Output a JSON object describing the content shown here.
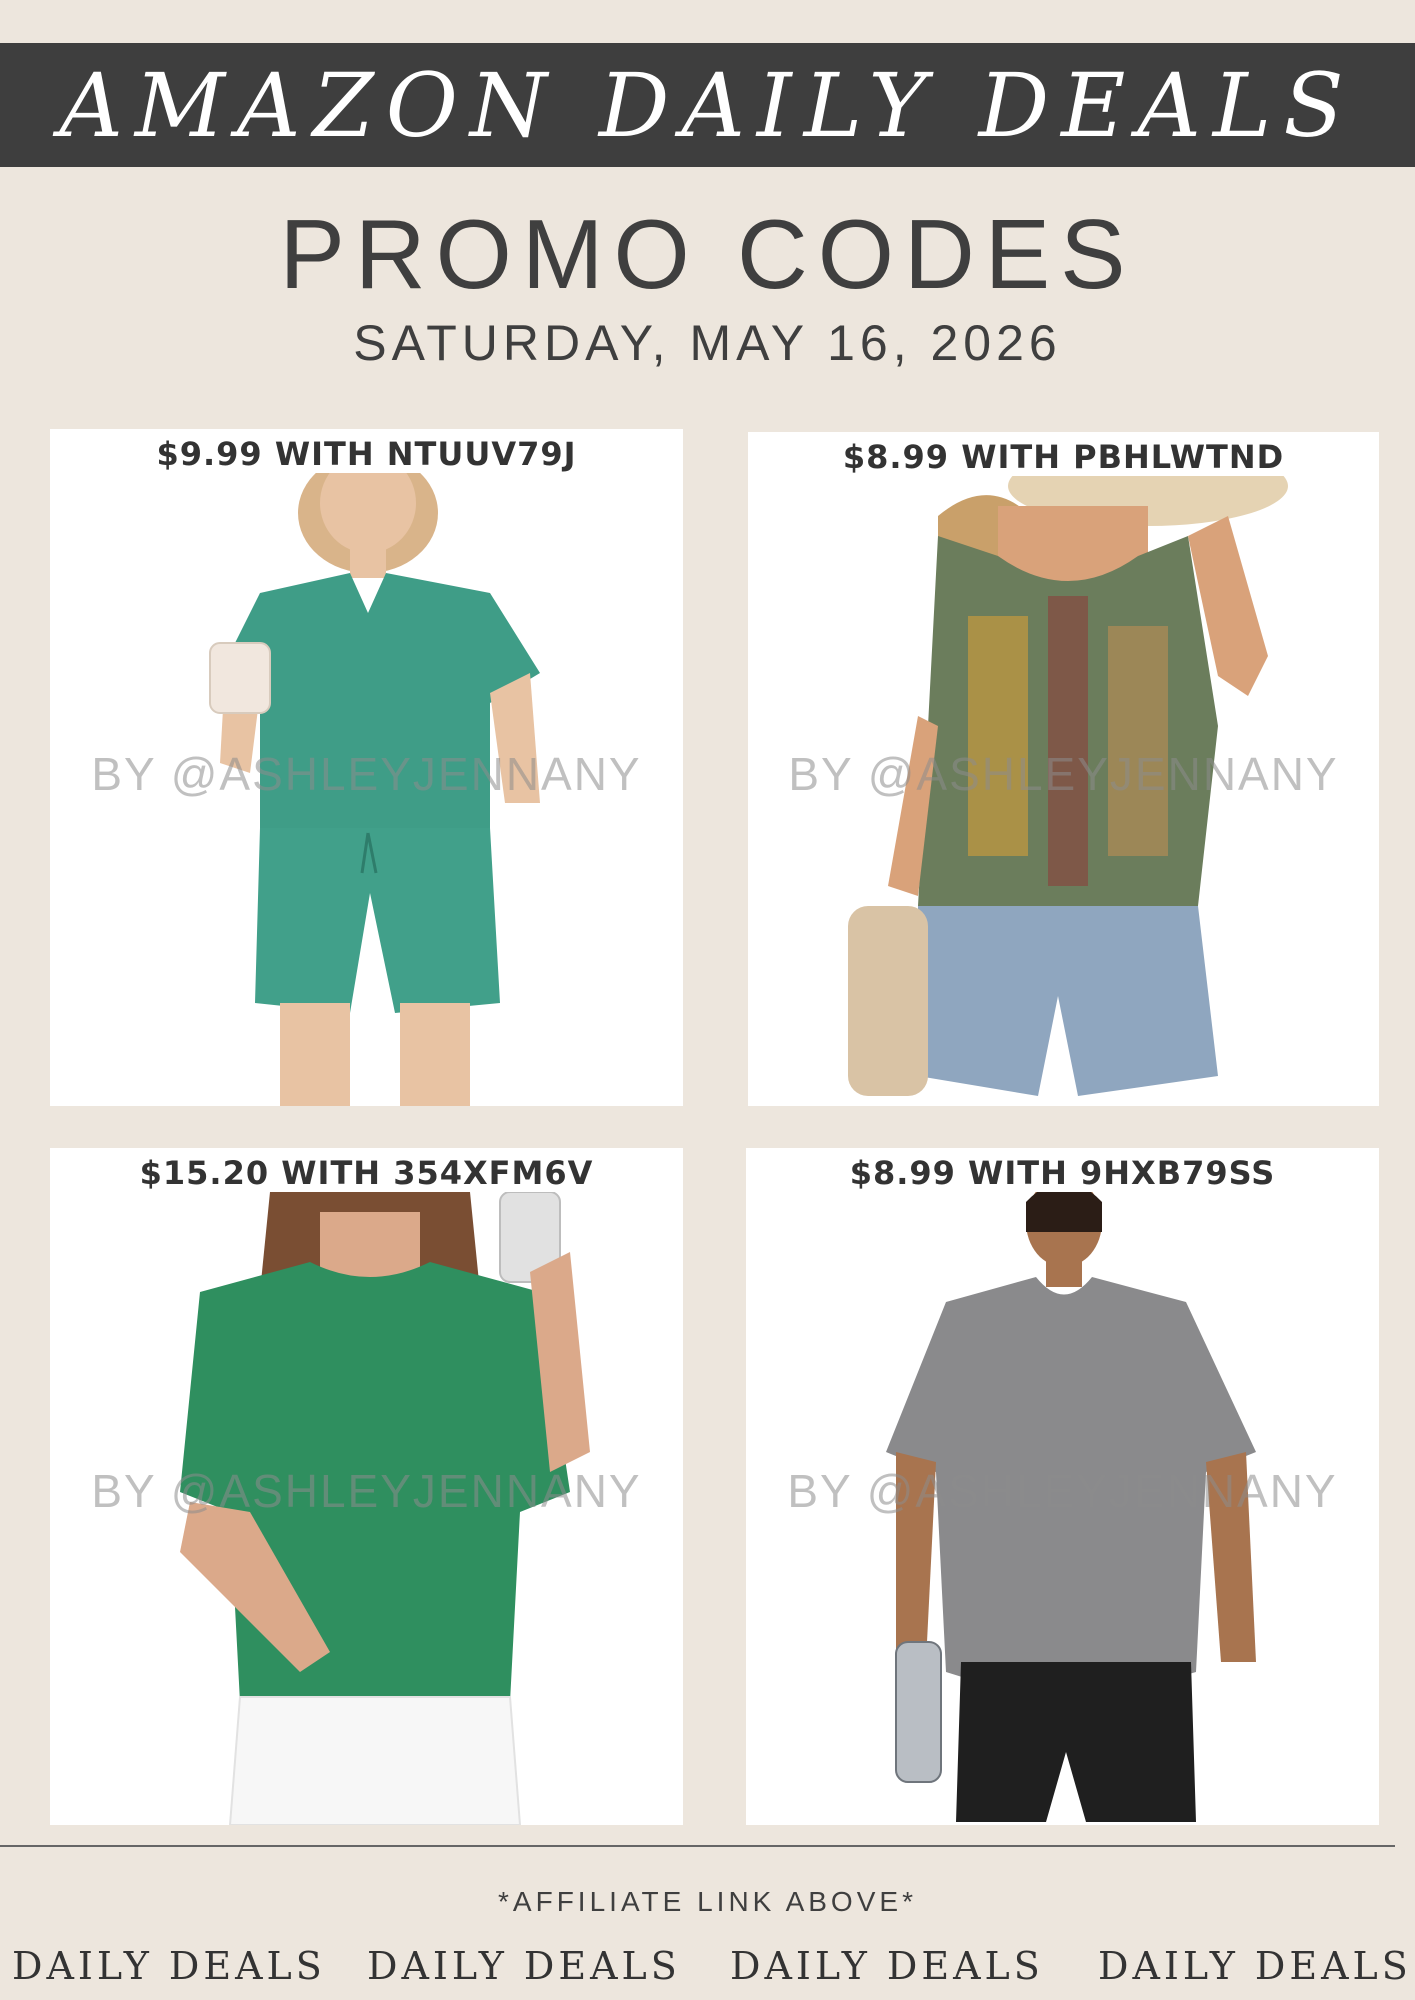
{
  "banner": {
    "title": "AMAZON DAILY DEALS"
  },
  "header": {
    "title": "PROMO CODES",
    "date": "SATURDAY, MAY 16, 2026"
  },
  "deals": [
    {
      "caption": "$9.99 WITH NTUUV79J",
      "watermark": "BY @ASHLEYJENNANY",
      "product": "green v-neck tee and shorts lounge set"
    },
    {
      "caption": "$8.99 WITH PBHLWTND",
      "watermark": "BY @ASHLEYJENNANY",
      "product": "paisley print tank top"
    },
    {
      "caption": "$15.20 WITH 354XFM6V",
      "watermark": "BY @ASHLEYJENNANY",
      "product": "green scalloped knit sweater tee"
    },
    {
      "caption": "$8.99 WITH 9HXB79SS",
      "watermark": "BY @ASHLEYJENNANY",
      "product": "grey athletic v-neck tee"
    }
  ],
  "footer": {
    "affiliate": "*AFFILIATE LINK ABOVE*",
    "words": [
      "DAILY DEALS",
      "DAILY DEALS",
      "DAILY DEALS",
      "DAILY DEALS"
    ]
  },
  "colors": {
    "background": "#ede6dd",
    "banner": "#3e3e3e",
    "text": "#3f3f3f",
    "green_set": "#3f9d87",
    "paisley_base": "#6b7d5c",
    "green_sweater": "#2f8f5f",
    "grey_tee": "#8a8a8c"
  }
}
